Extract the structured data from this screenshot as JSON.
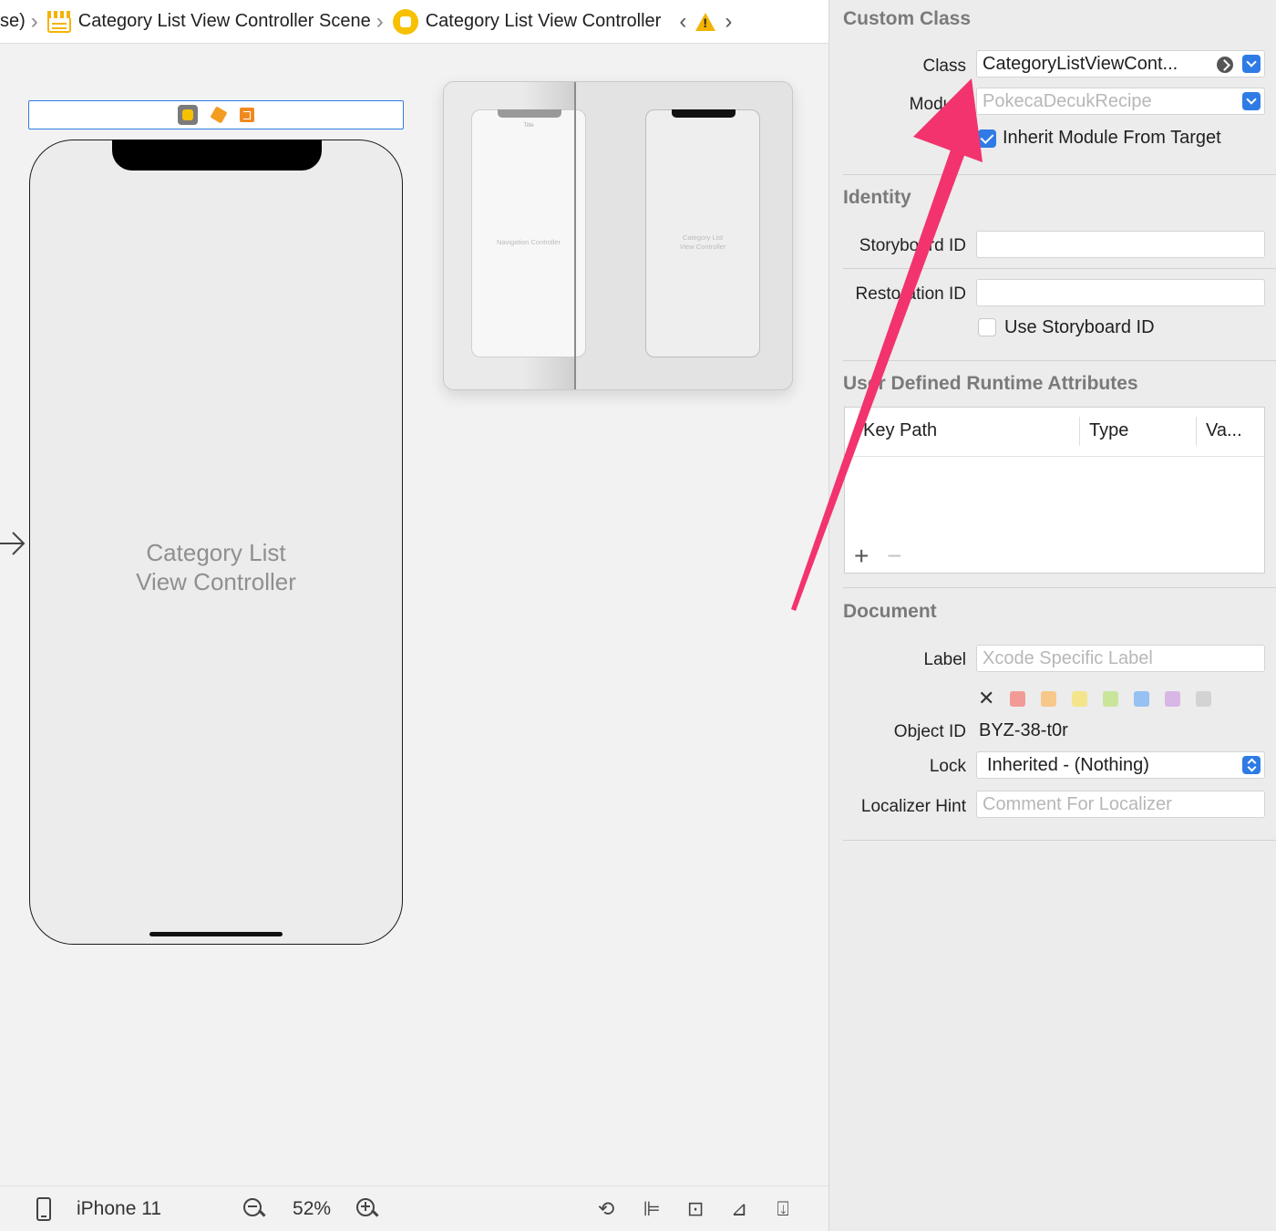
{
  "jumpbar": {
    "truncated_prefix": "se)",
    "scene_label": "Category List View Controller Scene",
    "controller_label": "Category List View Controller",
    "nav_back": "‹",
    "nav_forward": "›"
  },
  "canvas": {
    "phone_label_line1": "Category List",
    "phone_label_line2": "View Controller",
    "minimap": {
      "left_title": "Title",
      "left_label": "Navigation Controller",
      "right_label_line1": "Category List",
      "right_label_line2": "View Controller"
    }
  },
  "bottombar": {
    "device": "iPhone 11",
    "zoom": "52%"
  },
  "inspector": {
    "custom_class": {
      "title": "Custom Class",
      "class_label": "Class",
      "class_value": "CategoryListViewCont...",
      "module_label": "Module",
      "module_placeholder": "PokecaDecukRecipe",
      "inherit_label": "Inherit Module From Target",
      "inherit_checked": true
    },
    "identity": {
      "title": "Identity",
      "storyboard_id_label": "Storyboard ID",
      "storyboard_id_value": "",
      "restoration_id_label": "Restoration ID",
      "restoration_id_value": "",
      "use_storyboard_label": "Use Storyboard ID",
      "use_storyboard_checked": false
    },
    "runtime_attributes": {
      "title": "User Defined Runtime Attributes",
      "columns": [
        "Key Path",
        "Type",
        "Va..."
      ],
      "add": "+",
      "remove": "−"
    },
    "document": {
      "title": "Document",
      "label_label": "Label",
      "label_placeholder": "Xcode Specific Label",
      "swatch_clear": "✕",
      "swatch_colors": [
        "#f29b96",
        "#f7c889",
        "#f4e58c",
        "#c9e59a",
        "#95c2f2",
        "#d8b6e6",
        "#d3d3d3"
      ],
      "object_id_label": "Object ID",
      "object_id_value": "BYZ-38-t0r",
      "lock_label": "Lock",
      "lock_value": "Inherited - (Nothing)",
      "localizer_label": "Localizer Hint",
      "localizer_placeholder": "Comment For Localizer"
    }
  },
  "colors": {
    "accent": "#2f7be6",
    "annotation_arrow": "#f2336e",
    "scene_icon": "#f7c000"
  }
}
